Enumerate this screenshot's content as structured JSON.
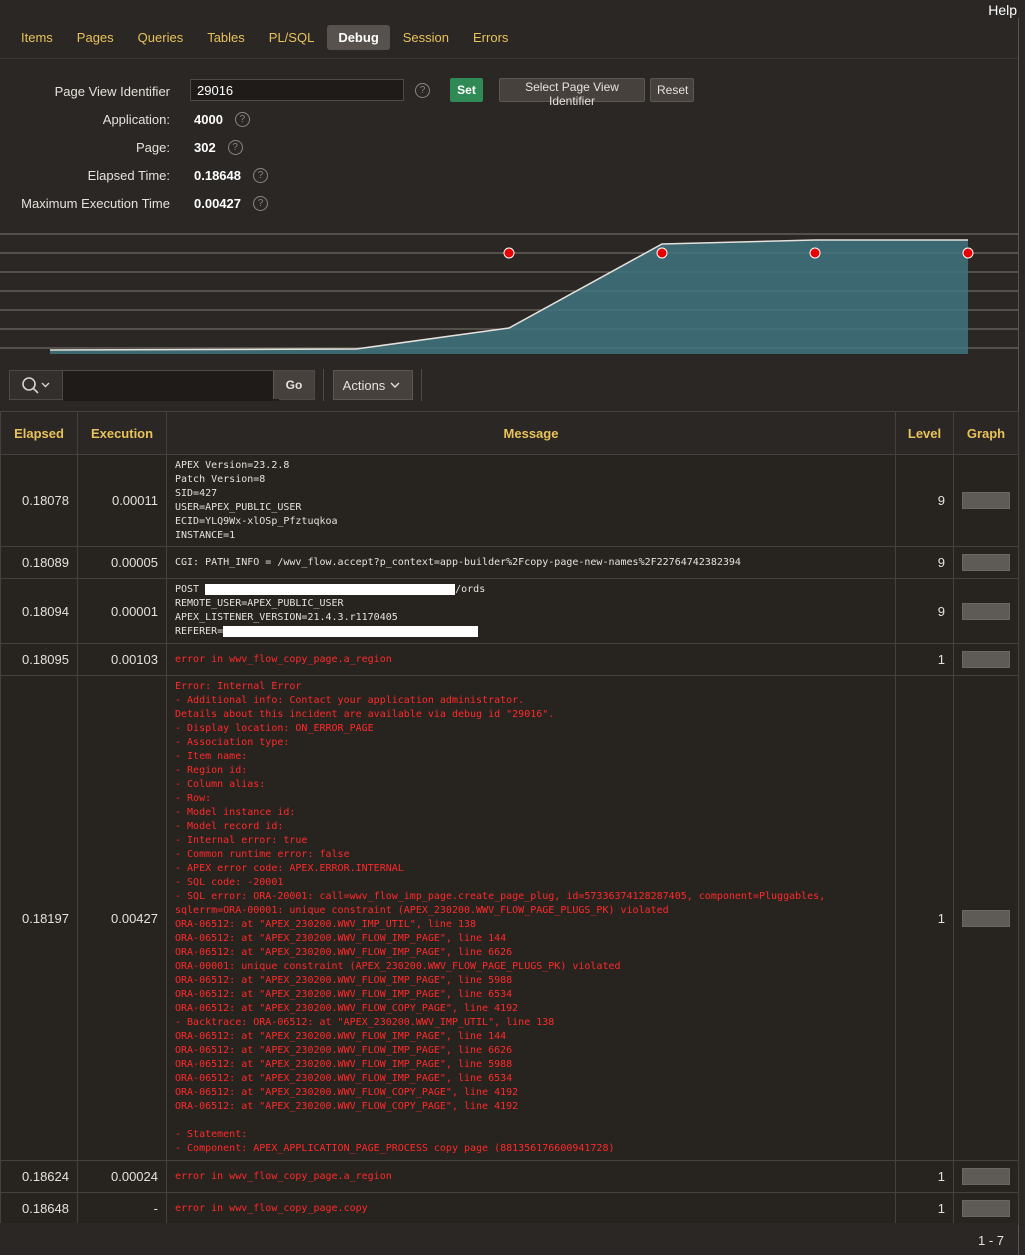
{
  "header": {
    "help": "Help",
    "tabs": [
      "Items",
      "Pages",
      "Queries",
      "Tables",
      "PL/SQL",
      "Debug",
      "Session",
      "Errors"
    ],
    "active_tab": "Debug"
  },
  "settings": {
    "page_view_identifier_label": "Page View Identifier",
    "page_view_identifier_value": "29016",
    "set_label": "Set",
    "select_pvi_label": "Select Page View Identifier",
    "reset_label": "Reset",
    "help_glyph": "?",
    "application_label": "Application:",
    "application_value": "4000",
    "page_label": "Page:",
    "page_value": "302",
    "elapsed_label": "Elapsed Time:",
    "elapsed_value": "0.18648",
    "max_exec_label": "Maximum Execution Time",
    "max_exec_value": "0.00427"
  },
  "chart_data": {
    "type": "area",
    "x": [
      0.18078,
      0.18089,
      0.18094,
      0.18095,
      0.18197,
      0.18624,
      0.18648
    ],
    "values": [
      0.00011,
      5e-05,
      1e-05,
      0.00103,
      0.00427,
      0.00024,
      0
    ],
    "fill_color": "#3f7480",
    "marker_color": "#e60000",
    "grid": true
  },
  "toolbar": {
    "go_label": "Go",
    "actions_label": "Actions",
    "search_value": ""
  },
  "grid": {
    "columns": [
      "Elapsed",
      "Execution",
      "Message",
      "Level",
      "Graph"
    ],
    "rows": [
      {
        "elapsed": "0.18078",
        "execution": "0.00011",
        "level": "9",
        "message": "APEX Version=23.2.8\nPatch Version=8\nSID=427\nUSER=APEX_PUBLIC_USER\nECID=YLQ9Wx-xlOSp_Pfztuqkoa\nINSTANCE=1"
      },
      {
        "elapsed": "0.18089",
        "execution": "0.00005",
        "level": "9",
        "message": "CGI: PATH_INFO = /wwv_flow.accept?p_context=app-builder%2Fcopy-page-new-names%2F22764742382394"
      },
      {
        "elapsed": "0.18094",
        "execution": "0.00001",
        "level": "9",
        "msg_post_prefix": "POST ",
        "msg_post_suffix": "/ords",
        "msg_line2": "REMOTE_USER=APEX_PUBLIC_USER",
        "msg_line3": "APEX_LISTENER_VERSION=21.4.3.r1170405",
        "msg_ref_prefix": "REFERER="
      },
      {
        "elapsed": "0.18095",
        "execution": "0.00103",
        "level": "1",
        "message": "error in wwv_flow_copy_page.a_region"
      },
      {
        "elapsed": "0.18197",
        "execution": "0.00427",
        "level": "1",
        "message": "Error: Internal Error\n- Additional info: Contact your application administrator.\nDetails about this incident are available via debug id \"29016\".\n- Display location: ON_ERROR_PAGE\n- Association type:\n- Item name:\n- Region id:\n- Column alias:\n- Row:\n- Model instance id:\n- Model record id:\n- Internal error: true\n- Common runtime error: false\n- APEX error code: APEX.ERROR.INTERNAL\n- SQL code: -20001\n- SQL error: ORA-20001: call=wwv_flow_imp_page.create_page_plug, id=57336374128287405, component=Pluggables,\nsqlerrm=ORA-00001: unique constraint (APEX_230200.WWV_FLOW_PAGE_PLUGS_PK) violated\nORA-06512: at \"APEX_230200.WWV_IMP_UTIL\", line 138\nORA-06512: at \"APEX_230200.WWV_FLOW_IMP_PAGE\", line 144\nORA-06512: at \"APEX_230200.WWV_FLOW_IMP_PAGE\", line 6626\nORA-00001: unique constraint (APEX_230200.WWV_FLOW_PAGE_PLUGS_PK) violated\nORA-06512: at \"APEX_230200.WWV_FLOW_IMP_PAGE\", line 5988\nORA-06512: at \"APEX_230200.WWV_FLOW_IMP_PAGE\", line 6534\nORA-06512: at \"APEX_230200.WWV_FLOW_COPY_PAGE\", line 4192\n- Backtrace: ORA-06512: at \"APEX_230200.WWV_IMP_UTIL\", line 138\nORA-06512: at \"APEX_230200.WWV_FLOW_IMP_PAGE\", line 144\nORA-06512: at \"APEX_230200.WWV_FLOW_IMP_PAGE\", line 6626\nORA-06512: at \"APEX_230200.WWV_FLOW_IMP_PAGE\", line 5988\nORA-06512: at \"APEX_230200.WWV_FLOW_IMP_PAGE\", line 6534\nORA-06512: at \"APEX_230200.WWV_FLOW_COPY_PAGE\", line 4192\nORA-06512: at \"APEX_230200.WWV_FLOW_COPY_PAGE\", line 4192\n\n- Statement:\n- Component: APEX_APPLICATION_PAGE_PROCESS copy page (881356176600941728)"
      },
      {
        "elapsed": "0.18624",
        "execution": "0.00024",
        "level": "1",
        "message": "error in wwv_flow_copy_page.a_region"
      },
      {
        "elapsed": "0.18648",
        "execution": "-",
        "level": "1",
        "message": "error in wwv_flow_copy_page.copy"
      }
    ]
  },
  "footer": {
    "pagination": "1 - 7"
  }
}
